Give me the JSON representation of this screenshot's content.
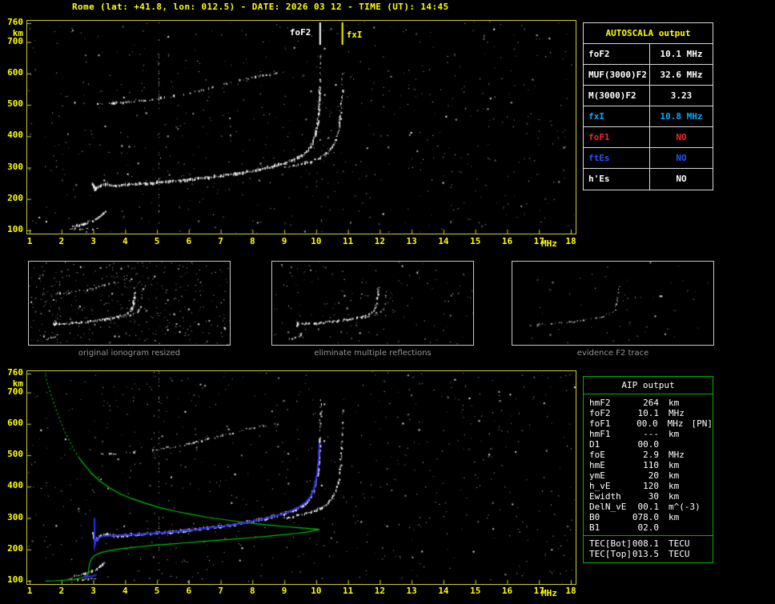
{
  "title": "Rome (lat: +41.8, lon: 012.5) - DATE: 2026 03 12 - TIME (UT): 14:45",
  "colors": {
    "background": "#000000",
    "axis_labels": "#ffff00",
    "plot_border": "#cccc33",
    "autoscala_border": "#d9d9d9",
    "aip_border": "#00b400",
    "ionogram_trace": "#ffffff",
    "density_profile": "#00c000",
    "restored_trace": "#2d2dff",
    "fxI_text": "#00aaff",
    "foF1_text": "#ff2020",
    "ftEs_text": "#2255ff"
  },
  "autoscala": {
    "header": "AUTOSCALA output",
    "rows": [
      {
        "label": "foF2",
        "value": "10.1 MHz",
        "color": "white"
      },
      {
        "label": "MUF(3000)F2",
        "value": "32.6 MHz",
        "color": "white"
      },
      {
        "label": "M(3000)F2",
        "value": "3.23",
        "color": "white"
      },
      {
        "label": "fxI",
        "value": "10.8 MHz",
        "color": "cyan"
      },
      {
        "label": "foF1",
        "value": "NO",
        "color": "red"
      },
      {
        "label": "ftEs",
        "value": "NO",
        "color": "blue"
      },
      {
        "label": "h'Es",
        "value": "NO",
        "color": "white"
      }
    ]
  },
  "thumbnails": [
    {
      "caption": "original ionogram resized"
    },
    {
      "caption": "eliminate multiple reflections"
    },
    {
      "caption": "evidence F2 trace"
    }
  ],
  "aip": {
    "header": "AIP output",
    "rows": [
      {
        "name": "hmF2",
        "value": "264",
        "unit": "km",
        "note": ""
      },
      {
        "name": "foF2",
        "value": "10.1",
        "unit": "MHz",
        "note": ""
      },
      {
        "name": "foF1",
        "value": "00.0",
        "unit": "MHz",
        "note": "[PN]"
      },
      {
        "name": "hmF1",
        "value": "---",
        "unit": "km",
        "note": ""
      },
      {
        "name": "D1",
        "value": "00.0",
        "unit": "",
        "note": ""
      },
      {
        "name": "foE",
        "value": "2.9",
        "unit": "MHz",
        "note": ""
      },
      {
        "name": "hmE",
        "value": "110",
        "unit": "km",
        "note": ""
      },
      {
        "name": "ymE",
        "value": "20",
        "unit": "km",
        "note": ""
      },
      {
        "name": "h_vE",
        "value": "120",
        "unit": "km",
        "note": ""
      },
      {
        "name": "Ewidth",
        "value": "30",
        "unit": "km",
        "note": ""
      },
      {
        "name": "DelN_vE",
        "value": "00.1",
        "unit": "m^(-3)",
        "note": ""
      },
      {
        "name": "B0",
        "value": "078.0",
        "unit": "km",
        "note": ""
      },
      {
        "name": "B1",
        "value": "02.0",
        "unit": "",
        "note": ""
      }
    ],
    "tec_rows": [
      {
        "name": "TEC[Bot]",
        "value": "008.1",
        "unit": "TECU",
        "note": ""
      },
      {
        "name": "TEC[Top]",
        "value": "013.5",
        "unit": "TECU",
        "note": ""
      }
    ]
  },
  "chart_data": {
    "type": "scatter",
    "title": "Ionogram: virtual height vs sounding frequency with AUTOSCALA interpretation",
    "x_axis": {
      "label": "MHz",
      "min": 1,
      "max": 18,
      "ticks": [
        1,
        2,
        3,
        4,
        5,
        6,
        7,
        8,
        9,
        10,
        11,
        12,
        13,
        14,
        15,
        16,
        17,
        18
      ]
    },
    "y_axis": {
      "label": "km",
      "min": 100,
      "max": 760,
      "ticks": [
        760,
        700,
        600,
        500,
        400,
        300,
        200,
        100
      ]
    },
    "annotations": [
      {
        "label": "foF2",
        "freq_mhz": 10.1,
        "color": "#ffffff"
      },
      {
        "label": "fxI",
        "freq_mhz": 10.8,
        "color": "#ffff00"
      }
    ],
    "interference_mhz": [
      5.05
    ],
    "traces": {
      "f2_ordinary": [
        [
          2.95,
          250
        ],
        [
          3.0,
          238
        ],
        [
          3.05,
          228
        ],
        [
          3.1,
          235
        ],
        [
          3.2,
          243
        ],
        [
          3.4,
          246
        ],
        [
          3.7,
          243
        ],
        [
          4.0,
          245
        ],
        [
          4.3,
          247
        ],
        [
          4.6,
          249
        ],
        [
          5.0,
          252
        ],
        [
          5.4,
          255
        ],
        [
          5.8,
          259
        ],
        [
          6.2,
          263
        ],
        [
          6.6,
          268
        ],
        [
          7.0,
          273
        ],
        [
          7.4,
          279
        ],
        [
          7.8,
          286
        ],
        [
          8.2,
          294
        ],
        [
          8.6,
          303
        ],
        [
          9.0,
          314
        ],
        [
          9.3,
          325
        ],
        [
          9.55,
          338
        ],
        [
          9.7,
          352
        ],
        [
          9.82,
          368
        ],
        [
          9.9,
          387
        ],
        [
          9.97,
          410
        ],
        [
          10.02,
          438
        ],
        [
          10.06,
          472
        ],
        [
          10.09,
          515
        ],
        [
          10.11,
          555
        ]
      ],
      "f2_extraordinary": [
        [
          9.0,
          300
        ],
        [
          9.4,
          308
        ],
        [
          9.8,
          318
        ],
        [
          10.1,
          330
        ],
        [
          10.35,
          346
        ],
        [
          10.5,
          364
        ],
        [
          10.6,
          386
        ],
        [
          10.68,
          415
        ],
        [
          10.74,
          455
        ],
        [
          10.78,
          505
        ],
        [
          10.8,
          545
        ]
      ],
      "f2_o_asymptote": [
        [
          10.11,
          570
        ],
        [
          10.12,
          610
        ],
        [
          10.13,
          650
        ],
        [
          10.15,
          690
        ]
      ],
      "f2_x_asymptote": [
        [
          10.8,
          560
        ],
        [
          10.81,
          600
        ],
        [
          10.82,
          645
        ]
      ],
      "second_hop": [
        [
          3.1,
          502
        ],
        [
          3.6,
          505
        ],
        [
          4.1,
          509
        ],
        [
          4.6,
          514
        ],
        [
          5.1,
          520
        ],
        [
          5.6,
          528
        ],
        [
          6.0,
          536
        ],
        [
          6.4,
          546
        ],
        [
          6.8,
          557
        ],
        [
          7.3,
          570
        ],
        [
          7.8,
          583
        ],
        [
          8.3,
          593
        ],
        [
          8.8,
          601
        ]
      ],
      "e_region": [
        [
          2.35,
          112
        ],
        [
          2.55,
          117
        ],
        [
          2.75,
          123
        ],
        [
          2.95,
          130
        ],
        [
          3.1,
          139
        ],
        [
          3.25,
          150
        ],
        [
          3.35,
          160
        ]
      ],
      "e_flat": [
        [
          2.2,
          105
        ],
        [
          2.5,
          104
        ],
        [
          2.8,
          105
        ],
        [
          3.1,
          106
        ]
      ]
    },
    "restored_trace": [
      [
        3.04,
        300
      ],
      [
        3.04,
        210
      ],
      [
        3.1,
        232
      ],
      [
        3.3,
        243
      ],
      [
        3.6,
        244
      ],
      [
        4.0,
        246
      ],
      [
        4.5,
        249
      ],
      [
        5.0,
        252
      ],
      [
        5.5,
        256
      ],
      [
        6.0,
        261
      ],
      [
        6.5,
        267
      ],
      [
        7.0,
        273
      ],
      [
        7.5,
        281
      ],
      [
        8.0,
        290
      ],
      [
        8.5,
        301
      ],
      [
        9.0,
        315
      ],
      [
        9.4,
        331
      ],
      [
        9.7,
        352
      ],
      [
        9.85,
        372
      ],
      [
        9.95,
        398
      ],
      [
        10.03,
        440
      ],
      [
        10.08,
        490
      ],
      [
        10.1,
        540
      ]
    ],
    "restored_e": [
      [
        2.7,
        112
      ],
      [
        2.9,
        114
      ],
      [
        3.1,
        118
      ]
    ],
    "profile": {
      "peak": {
        "foF2_mhz": 10.1,
        "hmF2_km": 264
      },
      "topside": [
        [
          10.1,
          264
        ],
        [
          9.6,
          268
        ],
        [
          9.1,
          272
        ],
        [
          8.6,
          277
        ],
        [
          8.1,
          282
        ],
        [
          7.6,
          288
        ],
        [
          7.1,
          295
        ],
        [
          6.6,
          302
        ],
        [
          6.1,
          311
        ],
        [
          5.6,
          321
        ],
        [
          5.1,
          333
        ],
        [
          4.6,
          348
        ],
        [
          4.2,
          362
        ],
        [
          3.8,
          379
        ],
        [
          3.5,
          397
        ],
        [
          3.2,
          418
        ],
        [
          2.95,
          442
        ],
        [
          2.75,
          466
        ],
        [
          2.55,
          492
        ],
        [
          2.4,
          518
        ],
        [
          2.25,
          546
        ],
        [
          2.1,
          576
        ],
        [
          1.97,
          608
        ],
        [
          1.85,
          640
        ],
        [
          1.74,
          672
        ],
        [
          1.63,
          706
        ],
        [
          1.53,
          740
        ],
        [
          1.5,
          758
        ]
      ],
      "bottomside": [
        [
          10.1,
          264
        ],
        [
          9.8,
          257
        ],
        [
          9.4,
          251
        ],
        [
          8.9,
          246
        ],
        [
          8.4,
          241
        ],
        [
          7.9,
          237
        ],
        [
          7.4,
          233
        ],
        [
          6.9,
          229
        ],
        [
          6.4,
          225
        ],
        [
          5.9,
          221
        ],
        [
          5.4,
          217
        ],
        [
          4.9,
          213
        ],
        [
          4.5,
          209
        ],
        [
          4.1,
          205
        ],
        [
          3.8,
          201
        ],
        [
          3.5,
          196
        ],
        [
          3.25,
          190
        ],
        [
          3.1,
          184
        ],
        [
          3.0,
          177
        ],
        [
          2.93,
          168
        ],
        [
          2.89,
          158
        ],
        [
          2.87,
          148
        ],
        [
          2.86,
          138
        ],
        [
          2.85,
          128
        ],
        [
          2.83,
          120
        ],
        [
          2.78,
          114
        ],
        [
          2.6,
          109
        ],
        [
          2.4,
          105
        ],
        [
          2.1,
          102
        ],
        [
          1.8,
          100
        ],
        [
          1.5,
          99
        ]
      ]
    }
  }
}
